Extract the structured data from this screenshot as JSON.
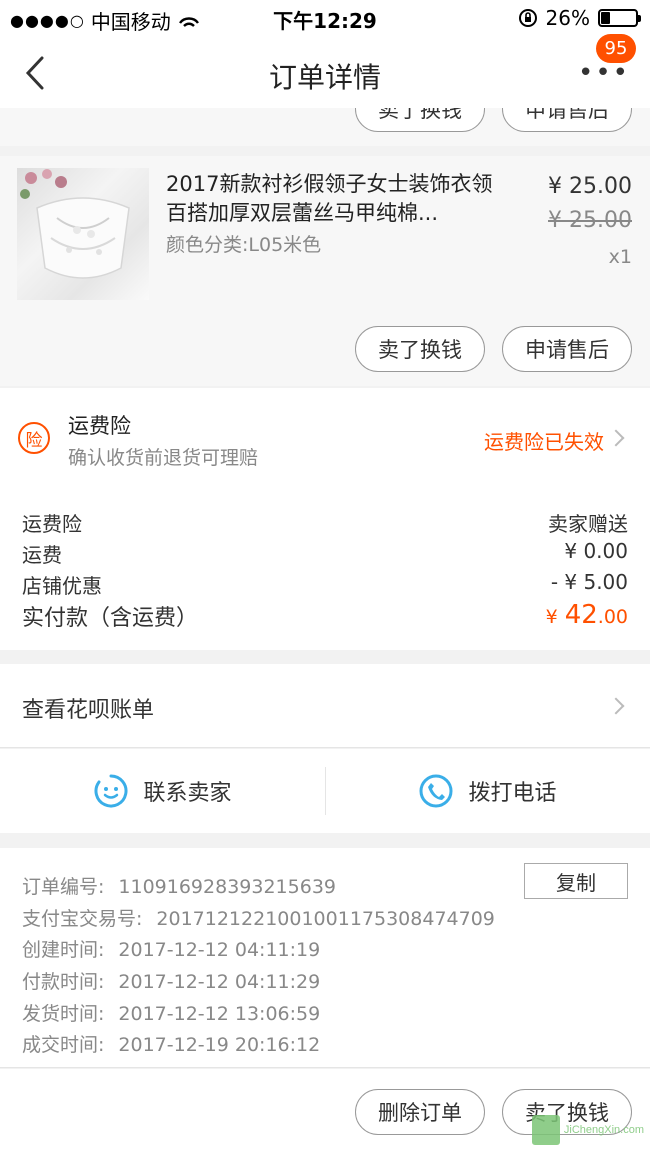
{
  "status_bar": {
    "signal": "●●●●○",
    "carrier": "中国移动",
    "time": "下午12:29",
    "battery_text": "26%",
    "battery_level": 0.26
  },
  "nav": {
    "title": "订单详情",
    "more": "•••",
    "badge": "95"
  },
  "partial_buttons": {
    "sell": "卖了换钱",
    "after_sales": "申请售后"
  },
  "product": {
    "name": "2017新款衬衫假领子女士装饰衣领百搭加厚双层蕾丝马甲纯棉...",
    "sku": "颜色分类:L05米色",
    "price": "¥ 25.00",
    "original_price": "¥ 25.00",
    "quantity": "x1",
    "sell_button": "卖了换钱",
    "after_sales_button": "申请售后"
  },
  "insurance": {
    "icon_char": "险",
    "title": "运费险",
    "subtitle": "确认收货前退货可理赔",
    "status": "运费险已失效"
  },
  "costs": [
    {
      "label": "运费险",
      "value": "卖家赠送"
    },
    {
      "label": "运费",
      "value": "¥ 0.00"
    },
    {
      "label": "店铺优惠",
      "value": "- ¥ 5.00"
    }
  ],
  "total": {
    "label": "实付款（含运费）",
    "currency": "¥",
    "integer": "42",
    "decimal": ".00"
  },
  "huabei": {
    "label": "查看花呗账单"
  },
  "contact": {
    "seller": "联系卖家",
    "phone": "拨打电话"
  },
  "order_info": {
    "copy_button": "复制",
    "rows": [
      {
        "label": "订单编号:",
        "value": "110916928393215639"
      },
      {
        "label": "支付宝交易号:",
        "value": "2017121221001001175308474709"
      },
      {
        "label": "创建时间:",
        "value": "2017-12-12 04:11:19"
      },
      {
        "label": "付款时间:",
        "value": "2017-12-12 04:11:29"
      },
      {
        "label": "发货时间:",
        "value": "2017-12-12 13:06:59"
      },
      {
        "label": "成交时间:",
        "value": "2017-12-19 20:16:12"
      }
    ]
  },
  "bottom_bar": {
    "delete": "删除订单",
    "sell": "卖了换钱"
  },
  "watermark": {
    "text": "JiChengXin.com"
  },
  "colors": {
    "accent": "#ff5000",
    "contact_blue": "#3aaee8",
    "watermark_green": "#7cc576"
  }
}
